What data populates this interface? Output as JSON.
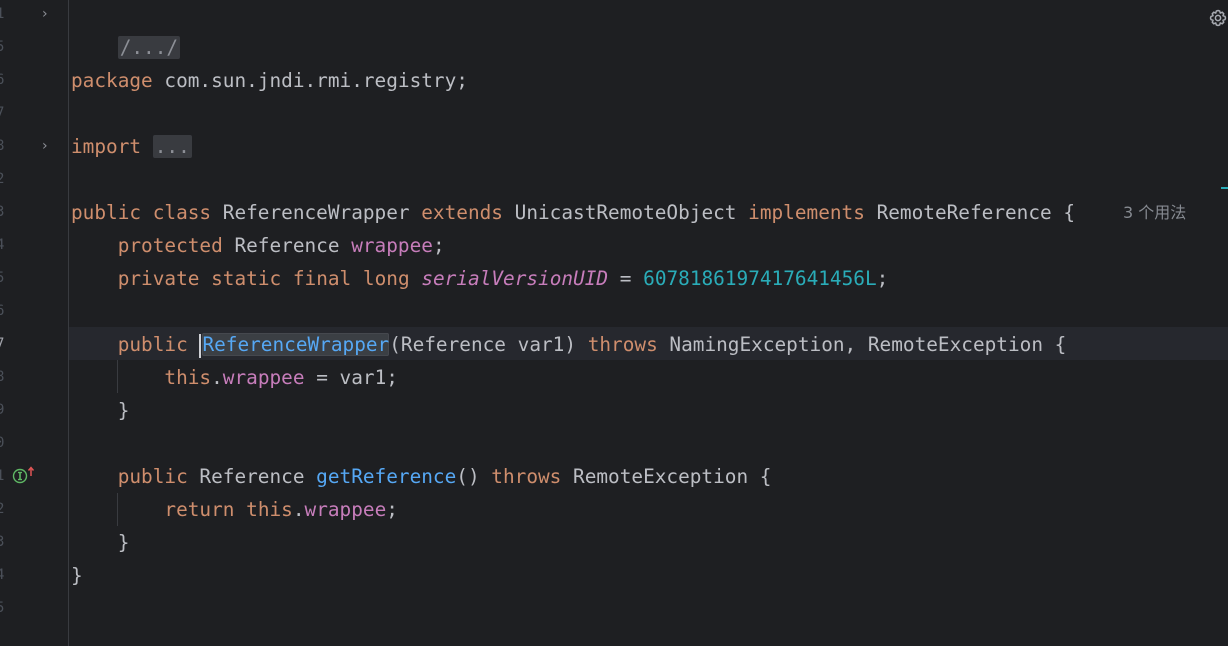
{
  "gutter": {
    "line_numbers": [
      "1",
      "5",
      "6",
      "7",
      "8",
      "2",
      "3",
      "4",
      "5",
      "6",
      "7",
      "8",
      "9",
      "0",
      "1",
      "2",
      "3",
      "4",
      "5"
    ],
    "active_line": "7"
  },
  "code": {
    "header_fold": "/.../",
    "package_kw": "package",
    "package_name": " com.sun.jndi.rmi.registry;",
    "import_kw": "import",
    "import_fold": "...",
    "cls_public": "public",
    "cls_class": "class",
    "cls_name": " ReferenceWrapper ",
    "cls_extends": "extends",
    "cls_super": " UnicastRemoteObject ",
    "cls_implements": "implements",
    "cls_iface": " RemoteReference {",
    "usages_hint": "3 个用法",
    "f1_protected": "protected",
    "f1_type": " Reference ",
    "f1_name": "wrappee",
    "f1_semi": ";",
    "f2_private": "private",
    "f2_static": "static",
    "f2_final": "final",
    "f2_long": "long",
    "f2_name": "serialVersionUID",
    "f2_eq": " = ",
    "f2_value": "6078186197417641456L",
    "f2_semi": ";",
    "ctor_public": "public",
    "ctor_name": "ReferenceWrapper",
    "ctor_params": "(Reference var1) ",
    "ctor_throws": "throws",
    "ctor_exc": " NamingException, RemoteException {",
    "ctor_this": "this",
    "ctor_dot": ".",
    "ctor_field": "wrappee",
    "ctor_assign": " = var1;",
    "close1": "}",
    "m_public": "public",
    "m_type": " Reference ",
    "m_name": "getReference",
    "m_parens": "() ",
    "m_throws": "throws",
    "m_exc": " RemoteException {",
    "r_return": "return",
    "r_this": "this",
    "r_dot": ".",
    "r_field": "wrappee",
    "r_semi": ";",
    "close2": "}",
    "close3": "}"
  },
  "icons": {
    "fold": "chevron-right-icon",
    "implements": "implementation-up-arrow-icon",
    "settings": "gear-icon"
  },
  "colors": {
    "background": "#1e1f22",
    "keyword": "#cf8e6d",
    "field": "#c77dbb",
    "number": "#2aacb8",
    "function": "#56a8f5",
    "text": "#bcbec4"
  }
}
